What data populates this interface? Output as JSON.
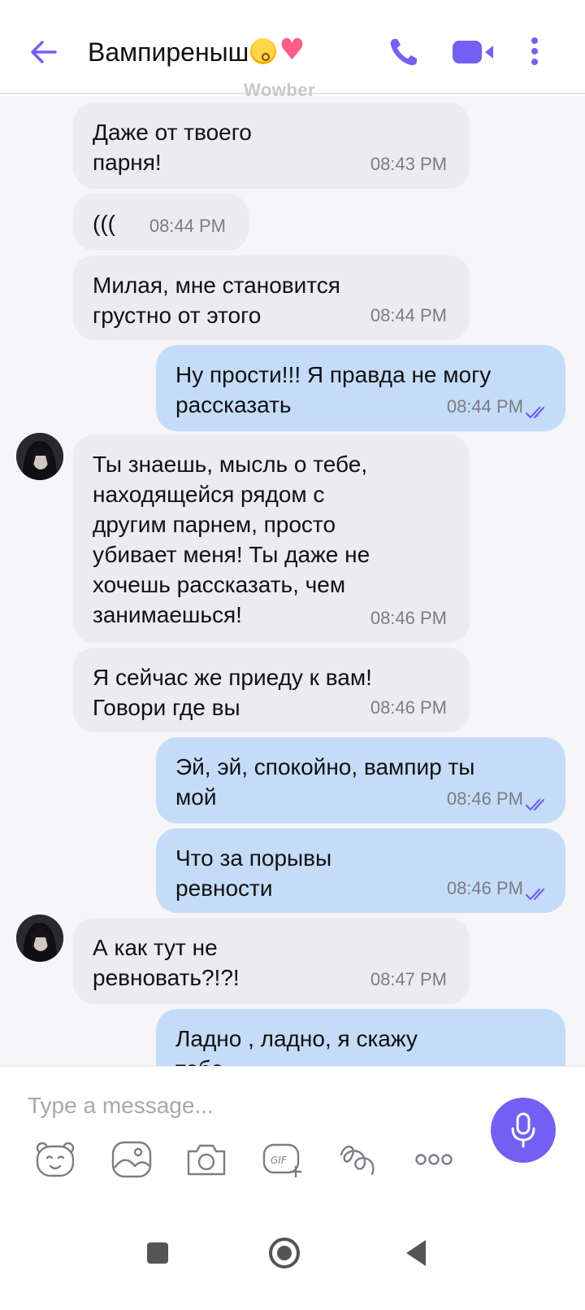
{
  "header": {
    "contact_name": "Вампиреныш",
    "watermark": "Wowber",
    "icons": {
      "back": "arrow-left-icon",
      "call": "phone-icon",
      "video": "video-camera-icon",
      "more": "more-vertical-icon"
    }
  },
  "messages": [
    {
      "dir": "in",
      "text": "Даже от твоего\nпарня!",
      "time": "08:43 PM"
    },
    {
      "dir": "in",
      "text": "(((",
      "time": "08:44 PM"
    },
    {
      "dir": "in",
      "text": "Милая, мне становится\nгрустно от этого",
      "time": "08:44 PM"
    },
    {
      "dir": "out",
      "text": "Ну прости!!! Я правда не могу\nрассказать",
      "time": "08:44 PM"
    },
    {
      "dir": "in",
      "text": "Ты знаешь, мысль о тебе,\nнаходящейся рядом с\nдругим парнем, просто\nубивает меня! Ты даже не\nхочешь рассказать, чем\nзанимаешься!",
      "time": "08:46 PM"
    },
    {
      "dir": "in",
      "text": "Я сейчас же приеду к вам!\nГовори где вы",
      "time": "08:46 PM"
    },
    {
      "dir": "out",
      "text": "Эй, эй, спокойно, вампир ты\nмой",
      "time": "08:46 PM"
    },
    {
      "dir": "out",
      "text": "Что за порывы\nревности",
      "time": "08:46 PM"
    },
    {
      "dir": "in",
      "text": "А как тут не\nревновать?!?!",
      "time": "08:47 PM"
    },
    {
      "dir": "out",
      "text": "Ладно , ладно, я скажу\nтебе",
      "time": ""
    }
  ],
  "composer": {
    "placeholder": "Type a message...",
    "tools": [
      "sticker-icon",
      "gallery-icon",
      "camera-icon",
      "gif-icon",
      "doodle-icon",
      "more-horizontal-icon"
    ],
    "mic": "microphone-icon"
  },
  "colors": {
    "accent": "#7360f2",
    "incoming_bubble": "#ececf0",
    "outgoing_bubble": "#c5dcf8",
    "chat_background": "#f6f6f8"
  }
}
